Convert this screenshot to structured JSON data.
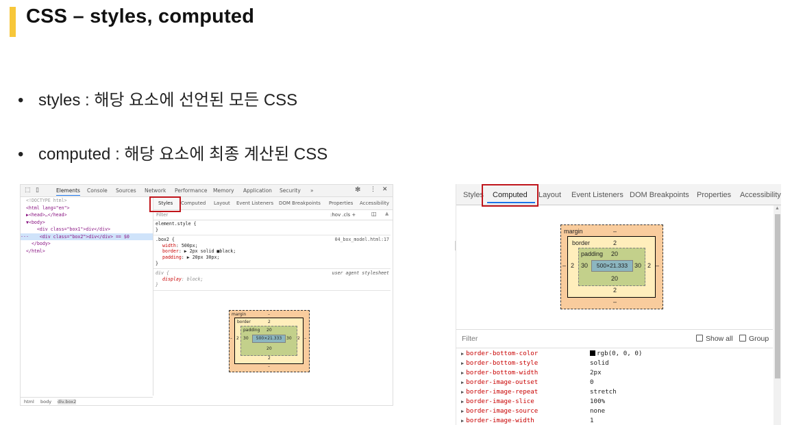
{
  "slide": {
    "title": "CSS – styles, computed",
    "bullets": [
      "styles : 해당 요소에 선언된 모든 CSS",
      "computed : 해당 요소에 최종 계산된 CSS"
    ],
    "accent_color": "#f7c73a"
  },
  "left_devtools": {
    "tabs": [
      "Elements",
      "Console",
      "Sources",
      "Network",
      "Performance",
      "Memory",
      "Application",
      "Security",
      "»"
    ],
    "active_tab": "Elements",
    "icons": [
      "inspect-icon",
      "device-icon",
      "settings-icon",
      "more-icon",
      "close-icon"
    ],
    "subtabs": [
      "Styles",
      "Computed",
      "Layout",
      "Event Listeners",
      "DOM Breakpoints",
      "Properties",
      "Accessibility"
    ],
    "active_subtab": "Styles",
    "dom_lines": [
      "<!DOCTYPE html>",
      "<html lang=\"en\">",
      "▶<head>…</head>",
      "▼<body>",
      "    <div class=\"box1\">div</div>",
      "    <div class=\"box2\">div</div> == $0",
      "  </body>",
      "</html>"
    ],
    "dom_selected_prefix": "···",
    "breadcrumbs": [
      "html",
      "body",
      "div.box2"
    ],
    "filter_placeholder": "Filter",
    "filter_tools": ":hov  .cls  +",
    "rules": {
      "element_style": "element.style {",
      "close": "}",
      "box2_selector": ".box2 {",
      "box2_source": "04_box_model.html:17",
      "box2_props": [
        {
          "name": "width",
          "value": "500px;"
        },
        {
          "name": "border",
          "value": "▶ 2px solid ■black;"
        },
        {
          "name": "padding",
          "value": "▶ 20px 30px;"
        }
      ],
      "div_selector": "div {",
      "div_source": "user agent stylesheet",
      "div_prop": {
        "name": "display",
        "value": "block;"
      }
    }
  },
  "box_model": {
    "margin_label": "margin",
    "margin_value": "–",
    "border_label": "border",
    "border_value": "2",
    "padding_label": "padding",
    "padding_value": "20",
    "content": "500×21.333",
    "left_margin": "–",
    "left_border": "2",
    "left_padding": "30",
    "right_padding": "30",
    "right_border": "2",
    "right_margin": "–",
    "bottom_padding": "20",
    "bottom_border": "2",
    "bottom_margin": "–"
  },
  "right_devtools": {
    "tabs": [
      "Styles",
      "Computed",
      "Layout",
      "Event Listeners",
      "DOM Breakpoints",
      "Properties",
      "Accessibility"
    ],
    "active_tab": "Computed",
    "filter_placeholder": "Filter",
    "show_all_label": "Show all",
    "group_label": "Group",
    "properties": [
      {
        "name": "border-bottom-color",
        "value": "rgb(0, 0, 0)"
      },
      {
        "name": "border-bottom-style",
        "value": "solid"
      },
      {
        "name": "border-bottom-width",
        "value": "2px"
      },
      {
        "name": "border-image-outset",
        "value": "0"
      },
      {
        "name": "border-image-repeat",
        "value": "stretch"
      },
      {
        "name": "border-image-slice",
        "value": "100%"
      },
      {
        "name": "border-image-source",
        "value": "none"
      },
      {
        "name": "border-image-width",
        "value": "1"
      }
    ],
    "highlight_color": "#c0141a"
  }
}
